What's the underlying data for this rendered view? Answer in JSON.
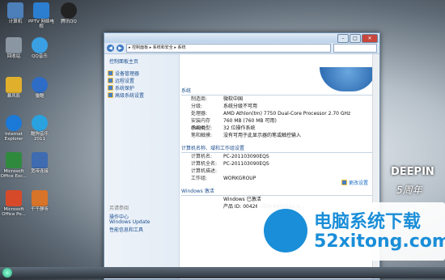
{
  "desktop": {
    "icons": [
      {
        "label": "计算机",
        "color": "#4d7fb9"
      },
      {
        "label": "PPTV 网络电视",
        "color": "#2c7fd0"
      },
      {
        "label": "腾讯QQ",
        "color": "#222222"
      },
      {
        "label": "回收站",
        "color": "#8b96a3"
      },
      {
        "label": "QQ音乐",
        "color": "#3aa0e3"
      },
      {
        "label": "暴风影",
        "color": "#e0b02c"
      },
      {
        "label": "優酷",
        "color": "#2d6cc7"
      },
      {
        "label": "Internet Explorer",
        "color": "#1b79d8"
      },
      {
        "label": "酷狗音乐 2011",
        "color": "#2aa2e0"
      },
      {
        "label": "Microsoft Office Exc...",
        "color": "#2f8a3d"
      },
      {
        "label": "宽带连接",
        "color": "#3f6bb0"
      },
      {
        "label": "Microsoft Office Po...",
        "color": "#d64a2a"
      },
      {
        "label": "千千静听",
        "color": "#d8732a"
      }
    ]
  },
  "window": {
    "breadcrumb": "▸ 控制面板 ▸ 系统和安全 ▸ 系统",
    "sidebar": {
      "home": "控制面板主页",
      "items": [
        "设备管理器",
        "远程设置",
        "系统保护",
        "高级系统设置"
      ],
      "see_also_title": "另请参阅",
      "see_also": [
        "操作中心",
        "Windows Update",
        "性能信息和工具"
      ]
    },
    "system_section": "系统",
    "system_rows": [
      {
        "k": "制造商:",
        "v": "微软中国"
      },
      {
        "k": "分级:",
        "v": "系统分级不可用"
      },
      {
        "k": "处理器:",
        "v": "AMD Athlon(tm) 7750 Dual-Core Processor   2.70 GHz"
      },
      {
        "k": "安装内存(RAM):",
        "v": "760 MB (760 MB 可用)"
      },
      {
        "k": "系统类型:",
        "v": "32 位操作系统"
      },
      {
        "k": "笔和触摸:",
        "v": "没有可用于此显示器的笔或触控输入"
      }
    ],
    "computer_section": "计算机名称、域和工作组设置",
    "change_settings": "更改设置",
    "computer_rows": [
      {
        "k": "计算机名:",
        "v": "PC-201103090EQS"
      },
      {
        "k": "计算机全名:",
        "v": "PC-201103090EQS"
      },
      {
        "k": "计算机描述:",
        "v": ""
      },
      {
        "k": "工作组:",
        "v": "WORKGROUP"
      }
    ],
    "activation_section": "Windows 激活",
    "activation_status": "Windows 已激活",
    "product_id": "产品 ID: 00426-OEM-8992662-0..."
  },
  "wallpaper": {
    "brand": "DEEPIN",
    "tagline": "5周年"
  },
  "watermark": {
    "title": "电脑系统下载",
    "url": "52xitong.com"
  }
}
